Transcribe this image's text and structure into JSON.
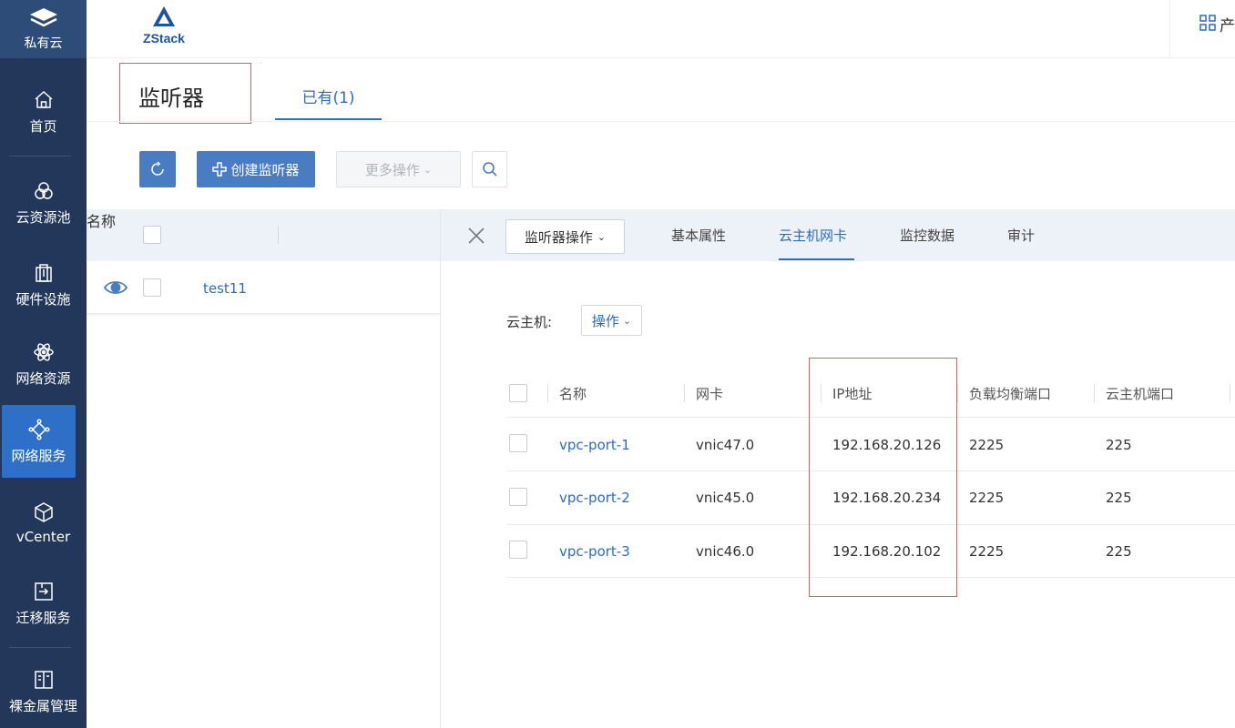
{
  "nav": {
    "top_label": "私有云",
    "items": [
      {
        "label": "首页",
        "icon": "home-icon"
      },
      {
        "label": "云资源池",
        "icon": "resource-pool-icon"
      },
      {
        "label": "硬件设施",
        "icon": "hardware-icon"
      },
      {
        "label": "网络资源",
        "icon": "network-resource-icon"
      },
      {
        "label": "网络服务",
        "icon": "network-service-icon"
      },
      {
        "label": "vCenter",
        "icon": "cube-icon"
      },
      {
        "label": "迁移服务",
        "icon": "migrate-icon"
      },
      {
        "label": "裸金属管理",
        "icon": "bare-metal-icon"
      }
    ],
    "active_item": "网络服务",
    "colors": {
      "background": "#22375a",
      "active": "#2e6fc8"
    }
  },
  "header": {
    "logo_text": "ZStack",
    "right_partial_text": "产"
  },
  "page": {
    "title": "监听器",
    "tab_existing": "已有(1)"
  },
  "toolbar": {
    "create_label": "创建监听器",
    "more_label": "更多操作"
  },
  "list": {
    "col_name": "名称",
    "rows": [
      {
        "name": "test11"
      }
    ]
  },
  "detail": {
    "op_dropdown": "监听器操作",
    "tabs": [
      "基本属性",
      "云主机网卡",
      "监控数据",
      "审计"
    ],
    "active_tab": "云主机网卡",
    "vm_label": "云主机:",
    "vm_op_label": "操作"
  },
  "nic_table": {
    "columns": [
      "名称",
      "网卡",
      "IP地址",
      "负载均衡端口",
      "云主机端口"
    ],
    "rows": [
      {
        "name": "vpc-port-1",
        "nic": "vnic47.0",
        "ip": "192.168.20.126",
        "lb_port": "2225",
        "vm_port": "225"
      },
      {
        "name": "vpc-port-2",
        "nic": "vnic45.0",
        "ip": "192.168.20.234",
        "lb_port": "2225",
        "vm_port": "225"
      },
      {
        "name": "vpc-port-3",
        "nic": "vnic46.0",
        "ip": "192.168.20.102",
        "lb_port": "2225",
        "vm_port": "225"
      }
    ]
  },
  "accent_color": "#2b6cc4",
  "highlight_color": "#e06060"
}
